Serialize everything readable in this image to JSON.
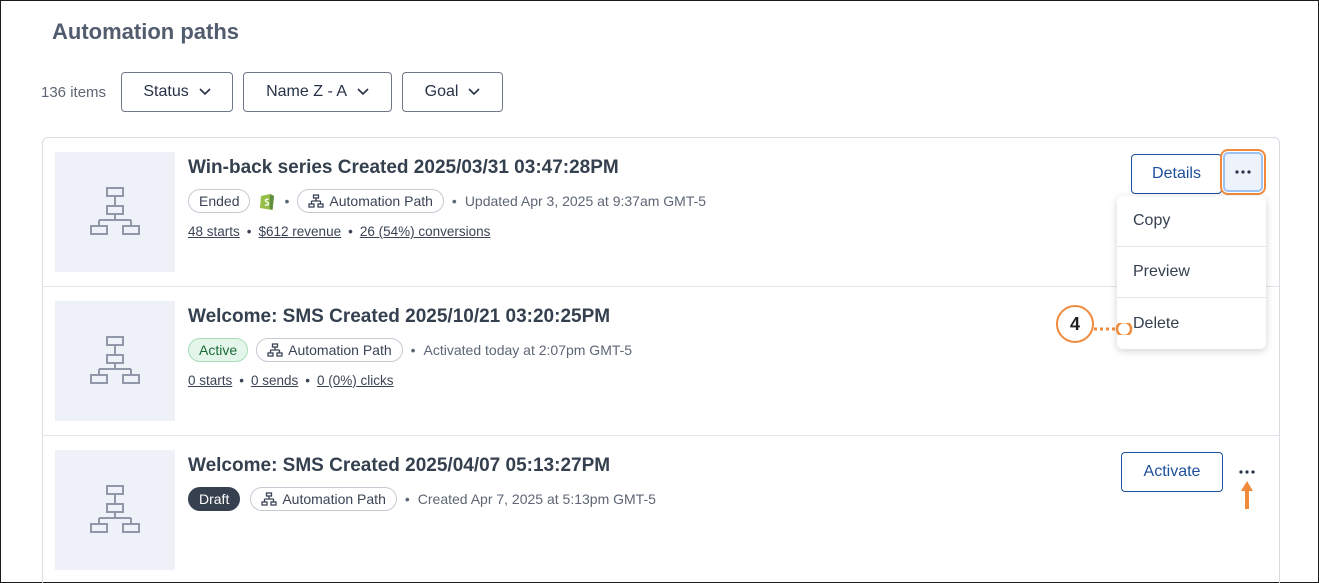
{
  "page": {
    "title": "Automation paths"
  },
  "toolbar": {
    "count": "136 items",
    "filters": [
      {
        "label": "Status"
      },
      {
        "label": "Name Z - A"
      },
      {
        "label": "Goal"
      }
    ]
  },
  "rows": [
    {
      "title": "Win-back series Created 2025/03/31 03:47:28PM",
      "status": "Ended",
      "type": "Automation Path",
      "timestamp": "Updated Apr 3, 2025 at 9:37am GMT-5",
      "stats": [
        "48 starts",
        "$612 revenue",
        "26 (54%) conversions"
      ],
      "action": "Details"
    },
    {
      "title": "Welcome: SMS Created 2025/10/21 03:20:25PM",
      "status": "Active",
      "type": "Automation Path",
      "timestamp": "Activated today at 2:07pm GMT-5",
      "stats": [
        "0 starts",
        "0 sends",
        "0 (0%) clicks"
      ]
    },
    {
      "title": "Welcome: SMS Created 2025/04/07 05:13:27PM",
      "status": "Draft",
      "type": "Automation Path",
      "timestamp": "Created Apr 7, 2025 at 5:13pm GMT-5",
      "action": "Activate"
    }
  ],
  "menu": {
    "items": [
      "Copy",
      "Preview",
      "Delete"
    ]
  },
  "callout": {
    "step": "4"
  },
  "colors": {
    "accent": "#1d4f9c",
    "callout": "#f08a3c",
    "active_bg": "#e4f6ea",
    "draft_bg": "#37404f"
  },
  "icons": {
    "chevron": "chevron-down-icon",
    "workflow": "workflow-icon",
    "more": "more-horizontal-icon",
    "shopify": "shopify-icon"
  }
}
